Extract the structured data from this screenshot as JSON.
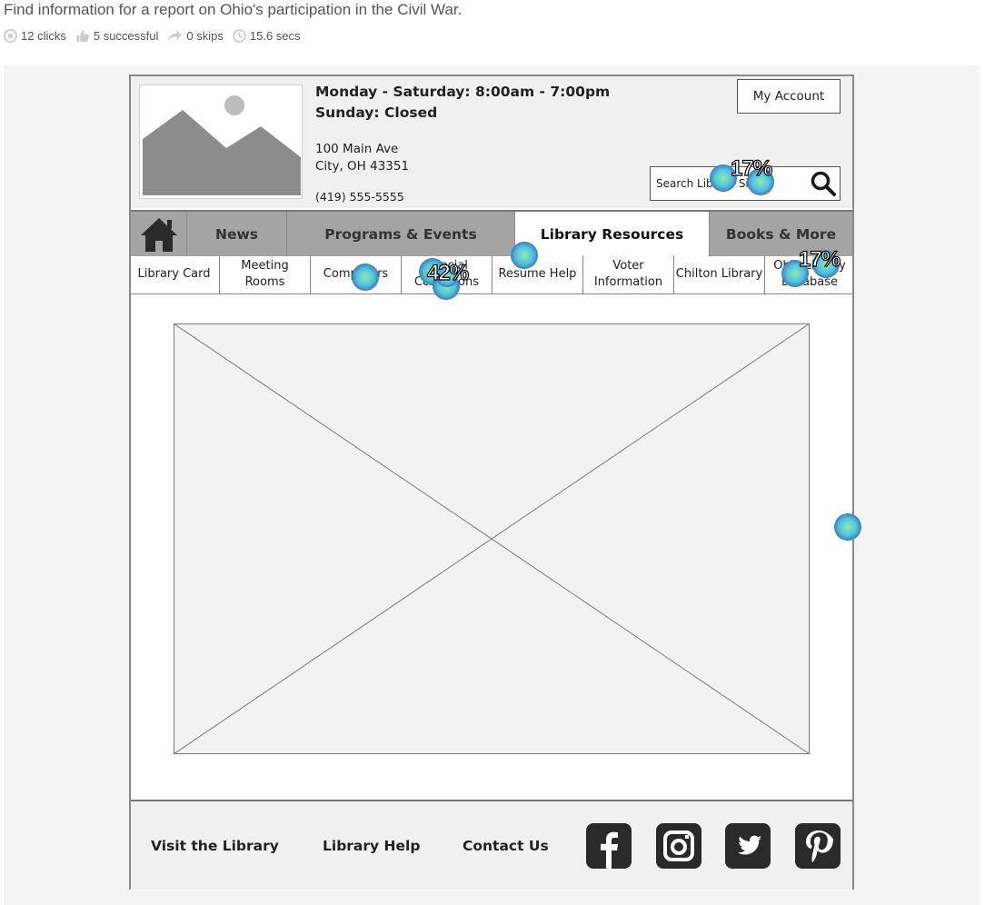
{
  "task": {
    "title": "Find information for a report on Ohio's participation in the Civil War.",
    "clicks": "12 clicks",
    "successful": "5 successful",
    "skips": "0 skips",
    "time": "15.6 secs"
  },
  "header": {
    "hours_line1": "Monday - Saturday: 8:00am - 7:00pm",
    "hours_line2": "Sunday: Closed",
    "address_line1": "100 Main Ave",
    "address_line2": "City, OH 43351",
    "phone": "(419) 555-5555",
    "account_button": "My Account",
    "search_placeholder": "Search Library Site"
  },
  "nav": {
    "tabs": [
      "News",
      "Programs & Events",
      "Library Resources",
      "Books & More"
    ],
    "active_tab": "Library Resources"
  },
  "subnav": {
    "items": [
      "Library Card",
      "Meeting Rooms",
      "Computers",
      "Special Collections",
      "Resume Help",
      "Voter Information",
      "Chilton Library",
      "Ohio Library Database"
    ]
  },
  "footer": {
    "links": [
      "Visit the Library",
      "Library Help",
      "Contact Us"
    ],
    "social_icons": [
      "facebook-icon",
      "instagram-icon",
      "twitter-icon",
      "pinterest-icon"
    ]
  },
  "heatmap": {
    "labels": [
      "17%",
      "42%",
      "17%"
    ],
    "click_count": 12
  },
  "colors": {
    "header_bg": "#f0f0f0",
    "nav_bg": "#a4a4a4",
    "border": "#8a8a8a",
    "heat_core": "#8fe8b0",
    "heat_mid": "#4fc3e0",
    "heat_edge": "#3f6fb3"
  }
}
